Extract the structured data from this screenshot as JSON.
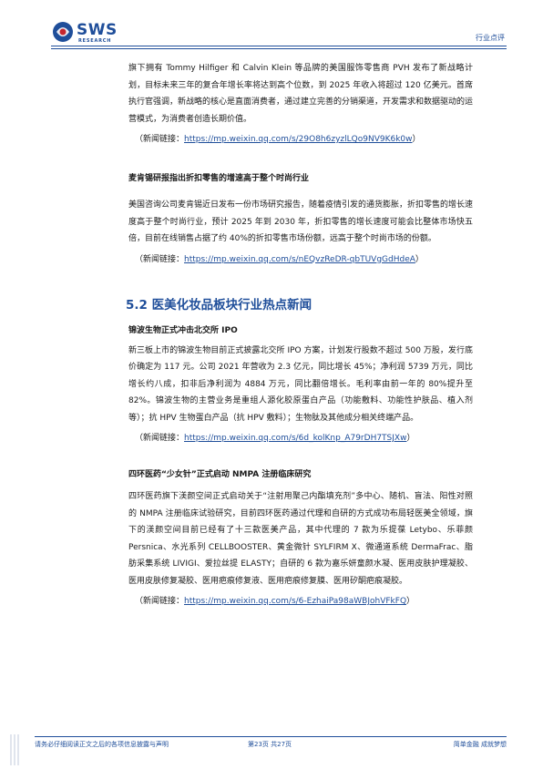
{
  "header": {
    "logo_text": "SWS",
    "logo_subtext": "RESEARCH",
    "tag": "行业点评",
    "brand_color": "#1f4e9a"
  },
  "blocks": {
    "pvh_para": "旗下拥有 Tommy Hilfiger 和 Calvin Klein 等品牌的美国服饰零售商 PVH 发布了新战略计划，目标未来三年的复合年增长率将达到高个位数，到 2025 年收入将超过 120 亿美元。首席执行官强调，新战略的核心是直面消费者，通过建立完善的分销渠道，开发需求和数据驱动的运营模式，为消费者创造长期价值。",
    "pvh_link_prefix": "（新闻链接：",
    "pvh_link": "https://mp.weixin.qq.com/s/29O8h6zyzlLQo9NV9K6k0w",
    "pvh_link_suffix": "）",
    "mck_title": "麦肯锡研报指出折扣零售的增速高于整个时尚行业",
    "mck_para": "美国咨询公司麦肯锡近日发布一份市场研究报告，随着疫情引发的通货膨胀，折扣零售的增长速度高于整个时尚行业，预计 2025 年到 2030 年，折扣零售的增长速度可能会比整体市场快五倍，目前在线销售占据了约 40%的折扣零售市场份额，远高于整个时尚市场的份额。",
    "mck_link_prefix": "（新闻链接：",
    "mck_link": "https://mp.weixin.qq.com/s/nEQvzReDR-qbTUVgGdHdeA",
    "mck_link_suffix": "）",
    "section_title": "5.2 医美化妆品板块行业热点新闻",
    "jb_title": "锦波生物正式冲击北交所 IPO",
    "jb_para": "新三板上市的锦波生物目前正式披露北交所 IPO 方案，计划发行股数不超过 500 万股，发行底价确定为 117 元。公司 2021 年营收为 2.3 亿元，同比增长 45%；净利润 5739 万元，同比增长约八成，扣非后净利润为 4884 万元，同比翻倍增长。毛利率由前一年的 80%提升至 82%。锦波生物的主营业务是重组人源化胶原蛋白产品（功能敷料、功能性护肤品、植入剂等）；抗 HPV 生物蛋白产品（抗 HPV 敷料）；生物肽及其他成分相关终端产品。",
    "jb_link_prefix": "（新闻链接：",
    "jb_link": "https://mp.weixin.qq.com/s/6d_kolKnp_A79rDH7TSJXw",
    "jb_link_suffix": "）",
    "sh_title": "四环医药“少女针”正式启动 NMPA 注册临床研究",
    "sh_para": "四环医药旗下渼颜空间正式启动关于“注射用聚己内酯填充剂”多中心、随机、盲法、阳性对照的 NMPA 注册临床试验研究，目前四环医药通过代理和自研的方式成功布局轻医美全领域，旗下的渼颜空间目前已经有了十三款医美产品，其中代理的 7 款为乐提葆 Letybo、乐菲颜 Persnica、水光系列 CELLBOOSTER、黄金微针 SYLFIRM X、微通道系统 DermaFrac、脂肪采集系统 LIVIGI、爱拉丝提 ELASTY；自研的 6 款为嘉乐妍童颜水凝、医用皮肤护理凝胶、医用皮肤修复凝胶、医用疤痕修复液、医用疤痕修复膜、医用矽酮疤痕凝胶。",
    "sh_link_prefix": "（新闻链接：",
    "sh_link": "https://mp.weixin.qq.com/s/6-EzhaiPa98aWBJohVFkFQ",
    "sh_link_suffix": "）"
  },
  "footer": {
    "disclaimer": "请务必仔细阅读正文之后的各项信息披露与声明",
    "page": "第23页 共27页",
    "slogan": "简单金融 成就梦想"
  }
}
